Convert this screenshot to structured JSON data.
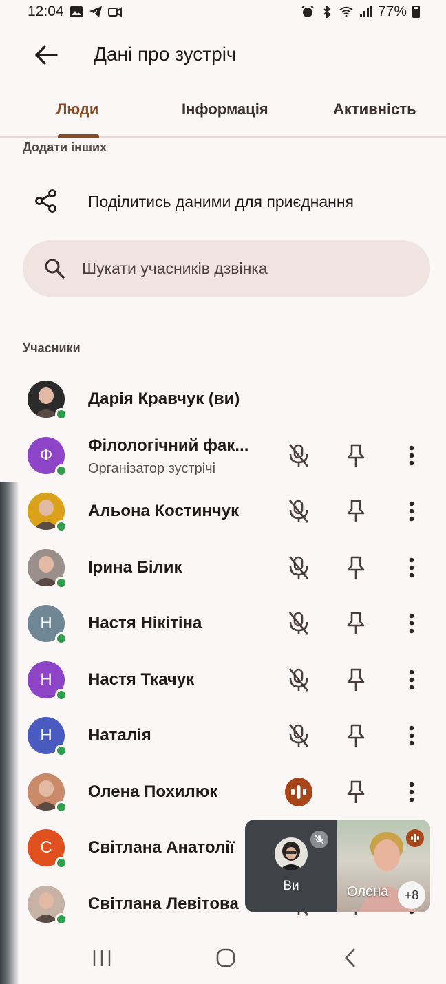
{
  "status_bar": {
    "time": "12:04",
    "battery": "77%",
    "icons": [
      "gallery-icon",
      "telegram-icon",
      "video-icon",
      "alarm-icon",
      "bluetooth-icon",
      "wifi-icon",
      "signal-icon",
      "battery-icon"
    ]
  },
  "header": {
    "title": "Дані про зустріч",
    "back_icon": "arrow-back-icon"
  },
  "tabs": [
    {
      "label": "Люди",
      "active": true
    },
    {
      "label": "Інформація",
      "active": false
    },
    {
      "label": "Активність",
      "active": false
    }
  ],
  "add_others": {
    "section_label": "Додати інших",
    "share_label": "Поділитись даними для приєднання",
    "share_icon": "share-icon"
  },
  "search": {
    "placeholder": "Шукати учасників дзвінка",
    "icon": "search-icon"
  },
  "participants_section": {
    "label": "Учасники",
    "items": [
      {
        "name": "Дарія Кравчук (ви)",
        "subtitle": "",
        "avatar_letter": "",
        "avatar_color": "#2b2b2b",
        "photo": true,
        "muted": false,
        "speaking": false,
        "actions": false
      },
      {
        "name": "Філологічний фак...",
        "subtitle": "Організатор зустрічі",
        "avatar_letter": "Ф",
        "avatar_color": "#8e44c6",
        "photo": false,
        "muted": true,
        "speaking": false,
        "actions": true
      },
      {
        "name": "Альона Костинчук",
        "subtitle": "",
        "avatar_letter": "",
        "avatar_color": "#d9a21a",
        "photo": true,
        "muted": true,
        "speaking": false,
        "actions": true
      },
      {
        "name": "Ірина Білик",
        "subtitle": "",
        "avatar_letter": "",
        "avatar_color": "#9a8f8a",
        "photo": true,
        "muted": true,
        "speaking": false,
        "actions": true
      },
      {
        "name": "Настя Нікітіна",
        "subtitle": "",
        "avatar_letter": "Н",
        "avatar_color": "#6f8794",
        "photo": false,
        "muted": true,
        "speaking": false,
        "actions": true
      },
      {
        "name": "Настя Ткачук",
        "subtitle": "",
        "avatar_letter": "Н",
        "avatar_color": "#8e44c6",
        "photo": false,
        "muted": true,
        "speaking": false,
        "actions": true
      },
      {
        "name": "Наталія",
        "subtitle": "",
        "avatar_letter": "Н",
        "avatar_color": "#4a5bc0",
        "photo": false,
        "muted": true,
        "speaking": false,
        "actions": true
      },
      {
        "name": "Олена Похилюк",
        "subtitle": "",
        "avatar_letter": "",
        "avatar_color": "#c98a6a",
        "photo": true,
        "muted": false,
        "speaking": true,
        "actions": true
      },
      {
        "name": "Світлана Анатолії",
        "subtitle": "",
        "avatar_letter": "С",
        "avatar_color": "#e0501e",
        "photo": false,
        "muted": true,
        "speaking": false,
        "actions": true
      },
      {
        "name": "Світлана Левітова",
        "subtitle": "",
        "avatar_letter": "",
        "avatar_color": "#c7b2a6",
        "photo": true,
        "muted": true,
        "speaking": false,
        "actions": true
      }
    ]
  },
  "pip": {
    "self_label": "Ви",
    "other_label": "Олена",
    "more_count": "+8"
  },
  "colors": {
    "accent": "#8a4a20",
    "speaking": "#a8461a",
    "online": "#2e9e4a",
    "search_bg": "#f0e4e1",
    "background": "#fbf7f6"
  }
}
